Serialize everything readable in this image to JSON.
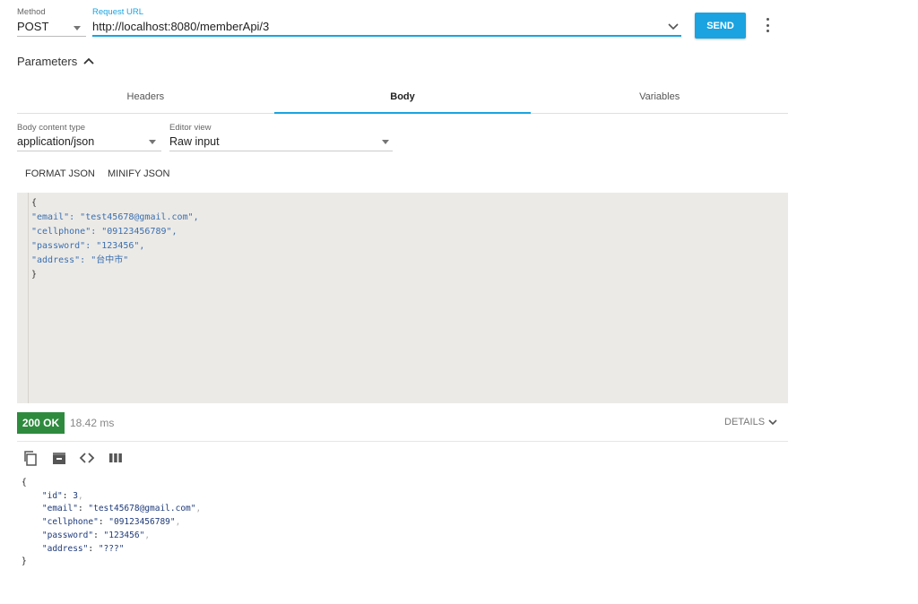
{
  "request": {
    "method_label": "Method",
    "method_value": "POST",
    "url_label": "Request URL",
    "url_value": "http://localhost:8080/memberApi/3",
    "send_label": "SEND"
  },
  "parameters": {
    "label": "Parameters",
    "tabs": [
      {
        "label": "Headers",
        "active": false
      },
      {
        "label": "Body",
        "active": true
      },
      {
        "label": "Variables",
        "active": false
      }
    ],
    "body_content_type_label": "Body content type",
    "body_content_type_value": "application/json",
    "editor_view_label": "Editor view",
    "editor_view_value": "Raw input",
    "format_json_label": "FORMAT JSON",
    "minify_json_label": "MINIFY JSON",
    "body_lines": [
      "{",
      "\"email\": \"test45678@gmail.com\",",
      "\"cellphone\": \"09123456789\",",
      "\"password\": \"123456\",",
      "\"address\": \"台中市\"",
      "}"
    ]
  },
  "response": {
    "status": "200 OK",
    "time": "18.42 ms",
    "details_label": "DETAILS",
    "body_lines": [
      {
        "key": "\"id\"",
        "value": "3",
        "comma": ","
      },
      {
        "key": "\"email\"",
        "value": "\"test45678@gmail.com\"",
        "comma": ","
      },
      {
        "key": "\"cellphone\"",
        "value": "\"09123456789\"",
        "comma": ","
      },
      {
        "key": "\"password\"",
        "value": "\"123456\"",
        "comma": ","
      },
      {
        "key": "\"address\"",
        "value": "\"???\"",
        "comma": ""
      }
    ],
    "open_brace": "{",
    "close_brace": "}"
  },
  "colors": {
    "accent": "#1aa3e0",
    "status_ok": "#2e8b3e",
    "editor_bg": "#eceae6"
  },
  "icons": {
    "copy": "copy-icon",
    "save": "save-icon",
    "code": "code-icon",
    "columns": "columns-icon"
  }
}
